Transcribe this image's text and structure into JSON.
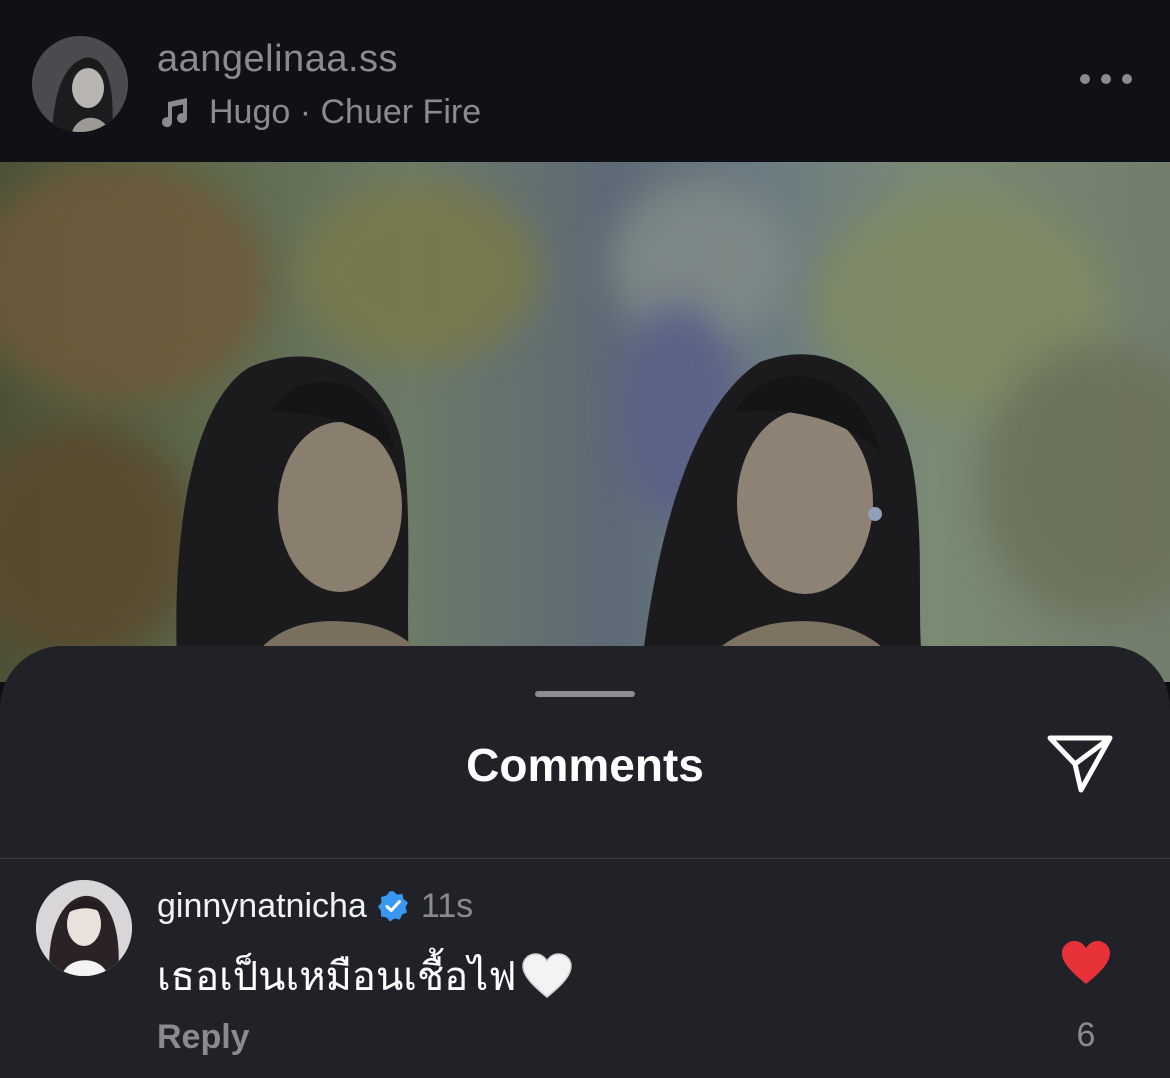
{
  "header": {
    "username": "aangelinaa.ss",
    "music_icon": "music-note-icon",
    "music": "Hugo · Chuer Fire",
    "more_icon": "more-horizontal-icon"
  },
  "sheet": {
    "title": "Comments",
    "share_icon": "paper-plane-icon"
  },
  "comment": {
    "username": "ginnynatnicha",
    "verified_icon": "verified-badge-icon",
    "time": "11s",
    "text": "เธอเป็นเหมือนเชื้อไฟ",
    "emoji_icon": "white-heart-icon",
    "reply": "Reply",
    "like_icon": "heart-icon",
    "like_count": "6"
  },
  "colors": {
    "background": "#0e0f13",
    "sheet": "#212227",
    "muted_text": "#8a8b8f",
    "like_red": "#e8323a",
    "verified_blue": "#3897f0"
  }
}
